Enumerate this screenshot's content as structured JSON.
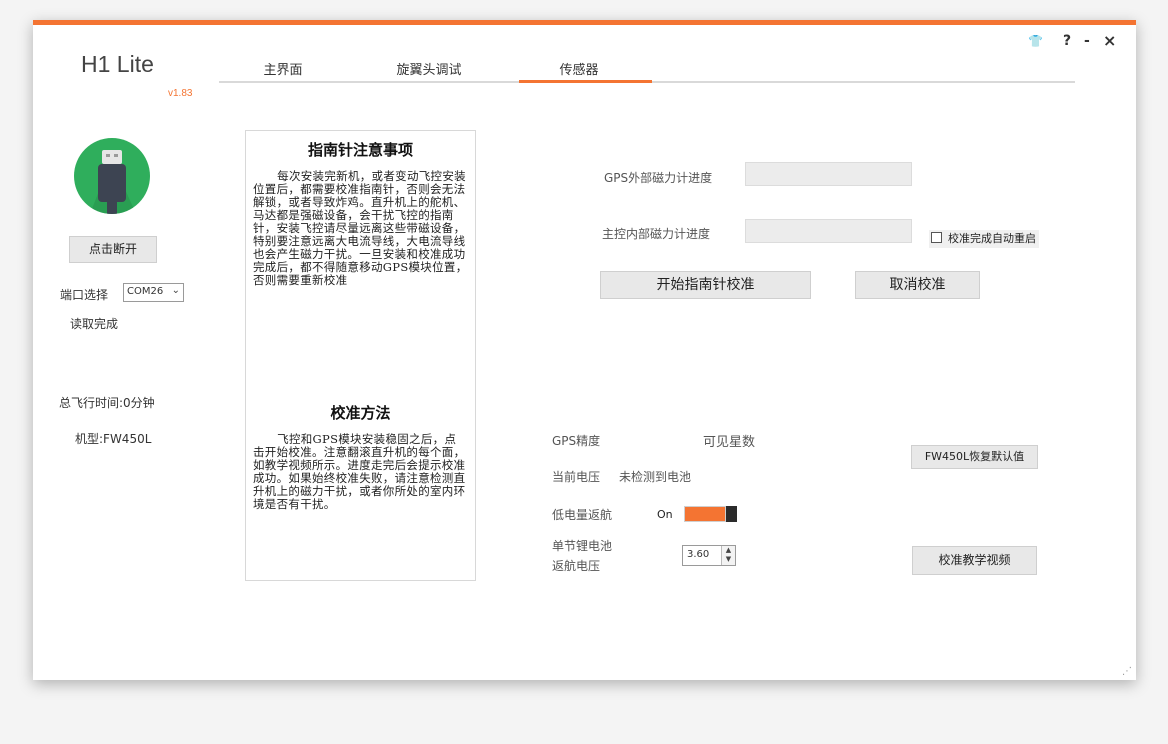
{
  "app": {
    "title": "H1 Lite",
    "version": "v1.83"
  },
  "window_controls": {
    "skin": "👕",
    "help": "?",
    "minimize": "-",
    "close": "×"
  },
  "tabs": [
    {
      "label": "主界面",
      "active": false
    },
    {
      "label": "旋翼头调试",
      "active": false
    },
    {
      "label": "传感器",
      "active": true
    }
  ],
  "sidebar": {
    "usb_icon": "usb-icon",
    "disconnect_label": "点击断开",
    "port_label": "端口选择",
    "port_value": "COM26",
    "read_status": "读取完成",
    "flight_time": "总飞行时间:0分钟",
    "model": "机型:FW450L"
  },
  "notice": {
    "title1": "指南针注意事项",
    "body1": "每次安装完新机，或者变动飞控安装位置后，都需要校准指南针，否则会无法解锁，或者导致炸鸡。直升机上的舵机、马达都是强磁设备，会干扰飞控的指南针，安装飞控请尽量远离这些带磁设备，特别要注意远离大电流导线，大电流导线也会产生磁力干扰。一旦安装和校准成功完成后，都不得随意移动GPS模块位置，否则需要重新校准",
    "title2": "校准方法",
    "body2": "飞控和GPS模块安装稳固之后，点击开始校准。注意翻滚直升机的每个面，如教学视频所示。进度走完后会提示校准成功。如果始终校准失败，请注意检测直升机上的磁力干扰，或者你所处的室内环境是否有干扰。"
  },
  "calibration": {
    "gps_mag_label": "GPS外部磁力计进度",
    "gps_mag_progress": 0,
    "main_mag_label": "主控内部磁力计进度",
    "main_mag_progress": 0,
    "auto_restart_label": "校准完成自动重启",
    "auto_restart_checked": false,
    "start_button": "开始指南针校准",
    "cancel_button": "取消校准"
  },
  "status": {
    "gps_accuracy_label": "GPS精度",
    "satellites_label": "可见星数",
    "voltage_label": "当前电压",
    "voltage_value": "未检测到电池",
    "low_battery_label": "低电量返航",
    "low_battery_state": "On",
    "cell_voltage_label_1": "单节锂电池",
    "cell_voltage_label_2": "返航电压",
    "cell_voltage_value": "3.60"
  },
  "buttons": {
    "restore_defaults": "FW450L恢复默认值",
    "tutorial_video": "校准教学视频"
  },
  "colors": {
    "accent": "#f47432",
    "usb_green": "#2fae5c"
  }
}
